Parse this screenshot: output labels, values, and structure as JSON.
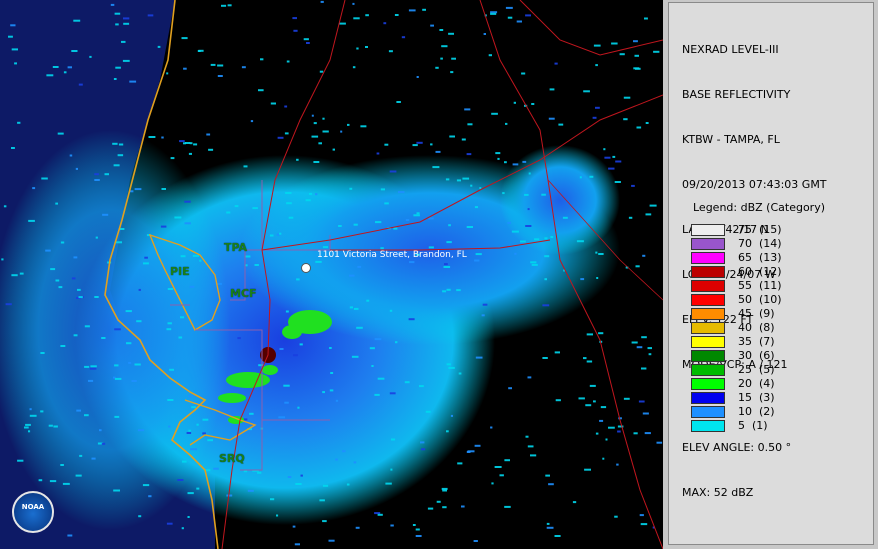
{
  "map": {
    "cities": [
      {
        "label": "TPA"
      },
      {
        "label": "PIE"
      },
      {
        "label": "MCF"
      },
      {
        "label": "SRQ"
      }
    ],
    "address_marker_label": "1101 Victoria Street, Brandon, FL",
    "logo_text": "NOAA",
    "colors": {
      "background": "#000000",
      "roads": "#c0161e",
      "coast": "#e0a020",
      "county": "#9a70c0",
      "city_label": "#1a7f1a"
    }
  },
  "panel": {
    "info_lines": [
      "NEXRAD LEVEL-III",
      "BASE REFLECTIVITY",
      "KTBW - TAMPA, FL",
      "09/20/2013 07:43:03 GMT",
      "LAT: 27/42/17 N",
      "LON: 82/24/07 W",
      "ELEV: 122 FT",
      "MODE/VCP: A / 121"
    ],
    "elev_angle": "ELEV ANGLE: 0.50 °",
    "max": "MAX: 52 dBZ",
    "legend_title": "Legend: dBZ (Category)",
    "legend": [
      {
        "label": "75  (15)",
        "color": "#eeeeee"
      },
      {
        "label": "70  (14)",
        "color": "#9955cc"
      },
      {
        "label": "65  (13)",
        "color": "#ff00ff"
      },
      {
        "label": "60  (12)",
        "color": "#bb0000"
      },
      {
        "label": "55  (11)",
        "color": "#dd0000"
      },
      {
        "label": "50  (10)",
        "color": "#ff0000"
      },
      {
        "label": "45  (9)",
        "color": "#ff8c00"
      },
      {
        "label": "40  (8)",
        "color": "#e6bb00"
      },
      {
        "label": "35  (7)",
        "color": "#ffff00"
      },
      {
        "label": "30  (6)",
        "color": "#008800"
      },
      {
        "label": "25  (5)",
        "color": "#00bb00"
      },
      {
        "label": "20  (4)",
        "color": "#00ff00"
      },
      {
        "label": "15  (3)",
        "color": "#0000ee"
      },
      {
        "label": "10  (2)",
        "color": "#1e90ff"
      },
      {
        "label": "5  (1)",
        "color": "#00e5ee"
      }
    ]
  }
}
